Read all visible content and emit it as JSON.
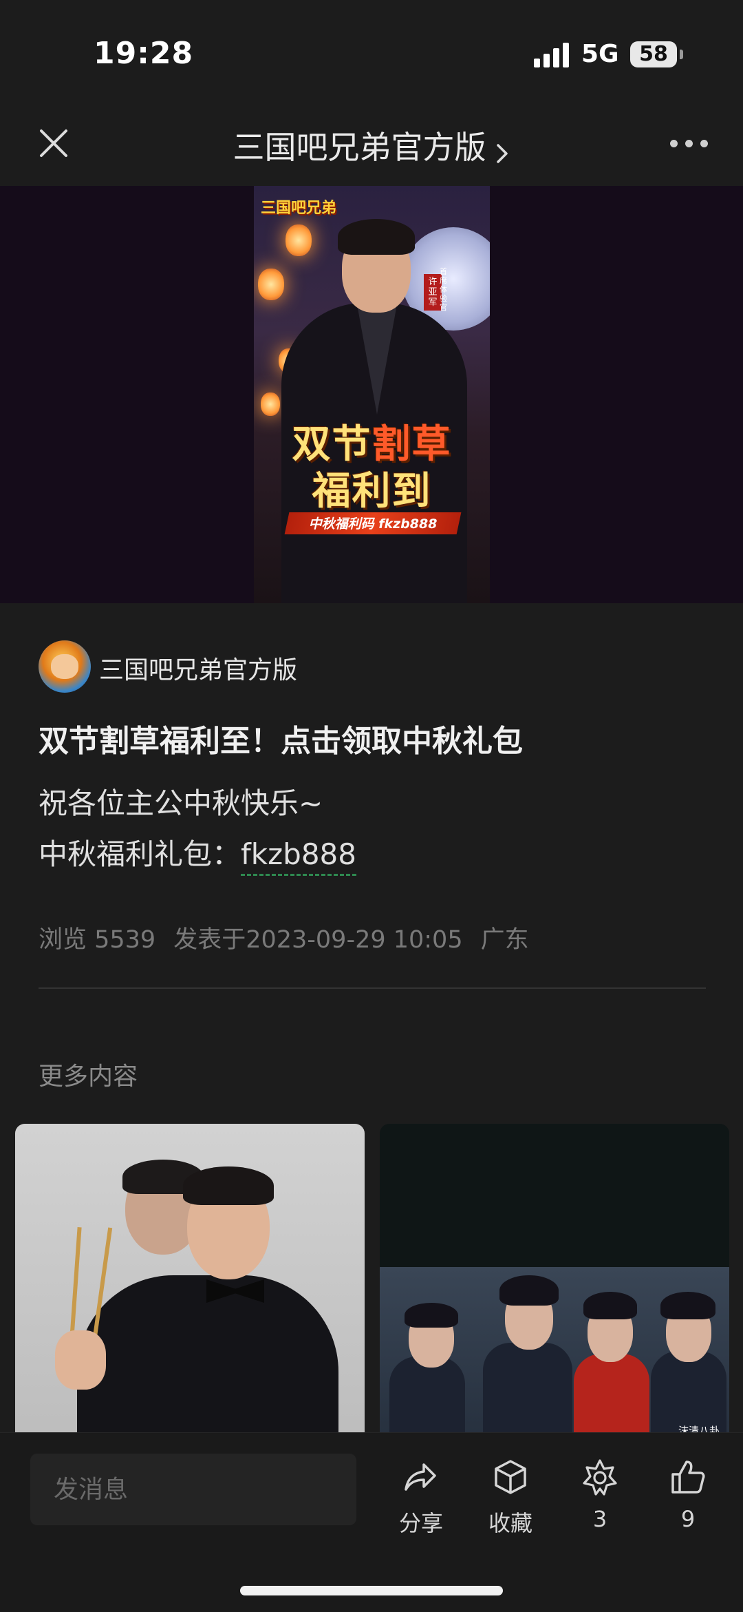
{
  "status_bar": {
    "time": "19:28",
    "network": "5G",
    "battery": "58"
  },
  "nav": {
    "title": "三国吧兄弟官方版"
  },
  "poster": {
    "logo_text": "三国吧兄弟",
    "name_tag": "许亚军",
    "name_caption": "首席体验官",
    "headline_1a": "双节",
    "headline_1b": "割草",
    "headline_2": "福利到",
    "code_line": "中秋福利码 fkzb888"
  },
  "article": {
    "author": "三国吧兄弟官方版",
    "title": "双节割草福利至！点击领取中秋礼包",
    "body_line_1": "祝各位主公中秋快乐~",
    "body_line_2_prefix": "中秋福利礼包：",
    "gift_code": "fkzb888",
    "views": "浏览 5539",
    "published": "发表于2023-09-29 10:05",
    "location": "广东"
  },
  "more": {
    "title": "更多内容",
    "cards": [
      {
        "watermark": ""
      },
      {
        "watermark": "沫清八卦"
      }
    ]
  },
  "bottom_bar": {
    "message_placeholder": "发消息",
    "share_label": "分享",
    "favorite_label": "收藏",
    "wow_count": "3",
    "like_count": "9"
  }
}
